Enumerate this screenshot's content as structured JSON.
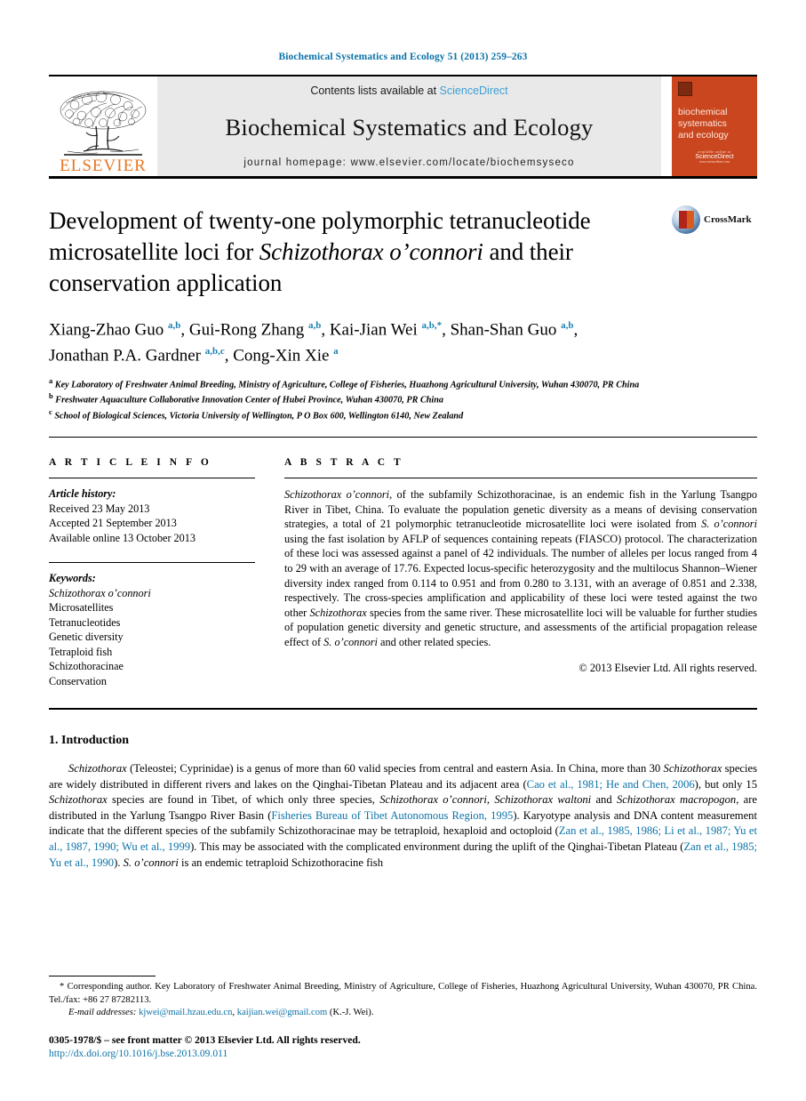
{
  "running_head": "Biochemical Systematics and Ecology 51 (2013) 259–263",
  "masthead": {
    "publisher_wordmark": "ELSEVIER",
    "contents_prefix": "Contents lists available at ",
    "contents_link": "ScienceDirect",
    "journal_title": "Biochemical Systematics and Ecology",
    "homepage": "journal homepage: www.elsevier.com/locate/biochemsyseco",
    "cover": {
      "line1": "biochemical",
      "line2": "systematics",
      "line3": "and ecology",
      "foot1": "available online at",
      "foot2": "ScienceDirect",
      "foot3": "www.sciencedirect.com"
    }
  },
  "title": {
    "part1": "Development of twenty-one polymorphic tetranucleotide microsatellite loci for ",
    "italic": "Schizothorax o’connori",
    "part2": " and their conservation application",
    "crossmark_label": "CrossMark"
  },
  "authors": {
    "list": "Xiang-Zhao Guo a,b, Gui-Rong Zhang a,b, Kai-Jian Wei a,b,*, Shan-Shan Guo a,b, Jonathan P.A. Gardner a,b,c, Cong-Xin Xie a",
    "affiliation_a": "Key Laboratory of Freshwater Animal Breeding, Ministry of Agriculture, College of Fisheries, Huazhong Agricultural University, Wuhan 430070, PR China",
    "affiliation_b": "Freshwater Aquaculture Collaborative Innovation Center of Hubei Province, Wuhan 430070, PR China",
    "affiliation_c": "School of Biological Sciences, Victoria University of Wellington, P O Box 600, Wellington 6140, New Zealand"
  },
  "article_info": {
    "heading": "A R T I C L E   I N F O",
    "history_label": "Article history:",
    "received": "Received 23 May 2013",
    "accepted": "Accepted 21 September 2013",
    "available_online": "Available online 13 October 2013",
    "keywords_label": "Keywords:",
    "keywords": [
      "Schizothorax o’connori",
      "Microsatellites",
      "Tetranucleotides",
      "Genetic diversity",
      "Tetraploid fish",
      "Schizothoracinae",
      "Conservation"
    ]
  },
  "abstract": {
    "heading": "A B S T R A C T",
    "species_lead": "Schizothorax o’connori",
    "text_part1": ", of the subfamily Schizothoracinae, is an endemic fish in the Yarlung Tsangpo River in Tibet, China. To evaluate the population genetic diversity as a means of devising conservation strategies, a total of 21 polymorphic tetranucleotide microsatellite loci were isolated from ",
    "species_mid1": "S. o’connori",
    "text_part2": " using the fast isolation by AFLP of sequences containing repeats (FIASCO) protocol. The characterization of these loci was assessed against a panel of 42 individuals. The number of alleles per locus ranged from 4 to 29 with an average of 17.76. Expected locus-specific heterozygosity and the multilocus Shannon–Wiener diversity index ranged from 0.114 to 0.951 and from 0.280 to 3.131, with an average of 0.851 and 2.338, respectively. The cross-species amplification and applicability of these loci were tested against the two other ",
    "species_mid2": "Schizothorax",
    "text_part3": " species from the same river. These microsatellite loci will be valuable for further studies of population genetic diversity and genetic structure, and assessments of the artificial propagation release effect of ",
    "species_mid3": "S. o’connori",
    "text_part4": " and other related species.",
    "copyright": "© 2013 Elsevier Ltd. All rights reserved."
  },
  "introduction": {
    "heading": "1. Introduction",
    "p1_a": "Schizothorax",
    "p1_b": " (Teleostei; Cyprinidae) is a genus of more than 60 valid species from central and eastern Asia. In China, more than 30 ",
    "p1_c": "Schizothorax",
    "p1_d": " species are widely distributed in different rivers and lakes on the Qinghai-Tibetan Plateau and its adjacent area (",
    "ref1": "Cao et al., 1981; He and Chen, 2006",
    "p1_e": "), but only 15 ",
    "p1_f": "Schizothorax",
    "p1_g": " species are found in Tibet, of which only three species, ",
    "p1_h": "Schizothorax o’connori, Schizothorax waltoni",
    "p1_i": " and ",
    "p1_j": "Schizothorax macropogon",
    "p1_k": ", are distributed in the Yarlung Tsangpo River Basin (",
    "ref2": "Fisheries Bureau of Tibet Autonomous Region, 1995",
    "p1_l": "). Karyotype analysis and DNA content measurement indicate that the different species of the subfamily Schizothoracinae may be tetraploid, hexaploid and octoploid (",
    "ref3": "Zan et al., 1985, 1986; Li et al., 1987; Yu et al., 1987, 1990; Wu et al., 1999",
    "p1_m": "). This may be associated with the complicated environment during the uplift of the Qinghai-Tibetan Plateau (",
    "ref4": "Zan et al., 1985; Yu et al., 1990",
    "p1_n": "). ",
    "p1_o": "S. o’connori",
    "p1_p": " is an endemic tetraploid Schizothoracine fish"
  },
  "footnotes": {
    "corresponding": "* Corresponding author. Key Laboratory of Freshwater Animal Breeding, Ministry of Agriculture, College of Fisheries, Huazhong Agricultural University, Wuhan 430070, PR China. Tel./fax: +86 27 87282113.",
    "email_label": "E-mail addresses:",
    "email1": "kjwei@mail.hzau.edu.cn",
    "email_sep": ", ",
    "email2": "kaijian.wei@gmail.com",
    "email_suffix": " (K.-J. Wei)."
  },
  "footer": {
    "issn_line": "0305-1978/$ – see front matter © 2013 Elsevier Ltd. All rights reserved.",
    "doi": "http://dx.doi.org/10.1016/j.bse.2013.09.011"
  },
  "colors": {
    "link_blue": "#0b72a8",
    "sciencedirect_blue": "#3c9fd4",
    "elsevier_orange": "#E87722",
    "cover_orange": "#C9461E"
  }
}
